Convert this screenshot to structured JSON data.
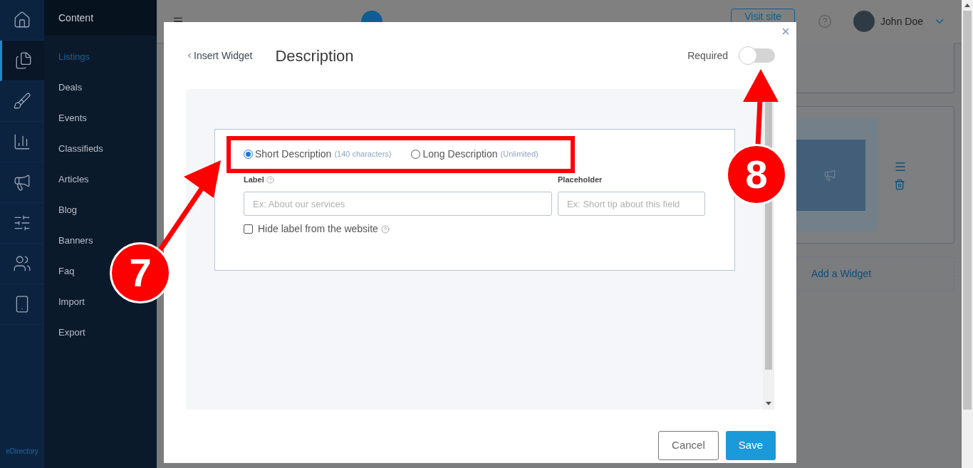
{
  "rail": {
    "icons": [
      {
        "kind": "home",
        "selected": false
      },
      {
        "kind": "documents",
        "selected": true
      },
      {
        "kind": "brush",
        "selected": false
      },
      {
        "kind": "chart",
        "selected": false
      },
      {
        "kind": "megaphone",
        "selected": false
      },
      {
        "kind": "sliders",
        "selected": false
      },
      {
        "kind": "users",
        "selected": false
      },
      {
        "kind": "mobile",
        "selected": false
      }
    ],
    "brand": "eDirectory"
  },
  "submenu": {
    "title": "Content",
    "items": [
      {
        "label": "Listings",
        "selected": true
      },
      {
        "label": "Deals",
        "selected": false
      },
      {
        "label": "Events",
        "selected": false
      },
      {
        "label": "Classifieds",
        "selected": false
      },
      {
        "label": "Articles",
        "selected": false
      },
      {
        "label": "Blog",
        "selected": false
      },
      {
        "label": "Banners",
        "selected": false
      },
      {
        "label": "Faq",
        "selected": false
      },
      {
        "label": "Import",
        "selected": false
      },
      {
        "label": "Export",
        "selected": false
      }
    ]
  },
  "header": {
    "visit_button": "Visit site",
    "user": "John Doe"
  },
  "background": {
    "add_widget": "Add a Widget"
  },
  "modal": {
    "back_link": "Insert Widget",
    "title": "Description",
    "required": {
      "label": "Required",
      "on": false
    },
    "options": [
      {
        "label": "Short Description",
        "note": "(140 characters)",
        "selected": true
      },
      {
        "label": "Long Description",
        "note": "(Unlimited)",
        "selected": false
      }
    ],
    "label_field": {
      "label": "Label",
      "placeholder": "Ex: About our services"
    },
    "placeholder_field": {
      "label": "Placeholder",
      "placeholder": "Ex: Short tip about this field"
    },
    "hide_label": {
      "label": "Hide label from the website",
      "checked": false
    },
    "buttons": [
      {
        "label": "Cancel",
        "kind": "secondary"
      },
      {
        "label": "Save",
        "kind": "primary"
      }
    ]
  },
  "annotations": [
    {
      "label": "7"
    },
    {
      "label": "8"
    }
  ]
}
